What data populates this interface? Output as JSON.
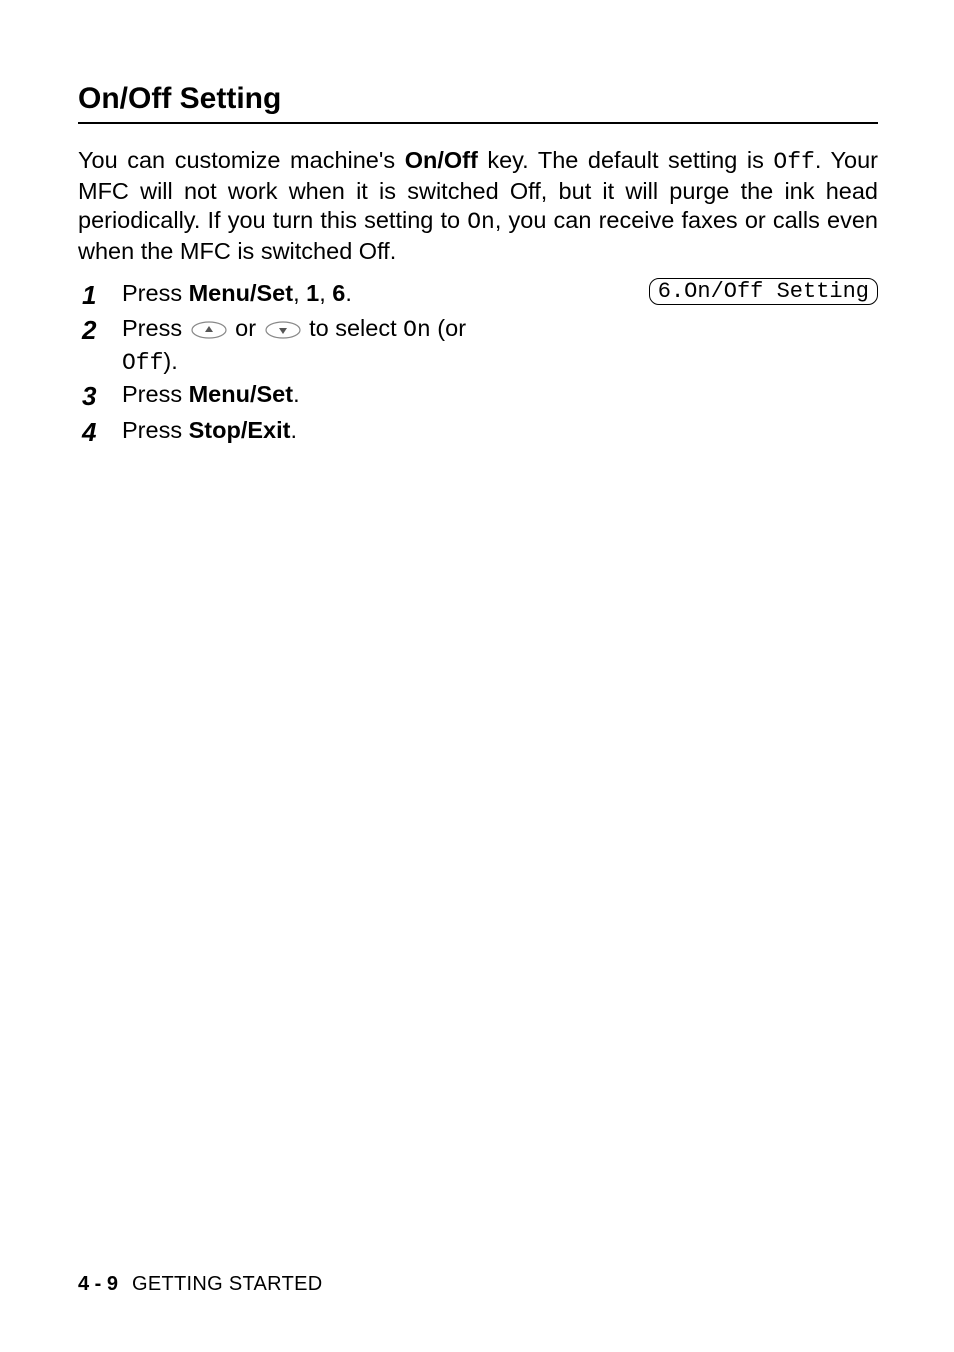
{
  "heading": "On/Off Setting",
  "intro": {
    "pre": "You can customize machine's ",
    "bold1": "On/Off",
    "mid1": " key. The default setting is ",
    "mono1": "Off",
    "mid2": ". Your MFC will not work when it is switched Off, but it will purge the ink head periodically. If you turn this setting to ",
    "mono2": "On",
    "post": ", you can receive faxes or calls even when the MFC is switched Off."
  },
  "lcd": "6.On/Off Setting",
  "steps": {
    "s1": {
      "num": "1",
      "t1": "Press ",
      "b1": "Menu/Set",
      "t2": ", ",
      "b2": "1",
      "t3": ", ",
      "b3": "6",
      "t4": "."
    },
    "s2": {
      "num": "2",
      "t1": "Press ",
      "t2": " or ",
      "t3": " to select ",
      "mono1": "On",
      "t4": " (or ",
      "mono2": "Off",
      "t5": ")."
    },
    "s3": {
      "num": "3",
      "t1": "Press ",
      "b1": "Menu/Set",
      "t2": "."
    },
    "s4": {
      "num": "4",
      "t1": "Press ",
      "b1": "Stop/Exit",
      "t2": "."
    }
  },
  "footer": {
    "page": "4 - 9",
    "section": "GETTING STARTED"
  }
}
